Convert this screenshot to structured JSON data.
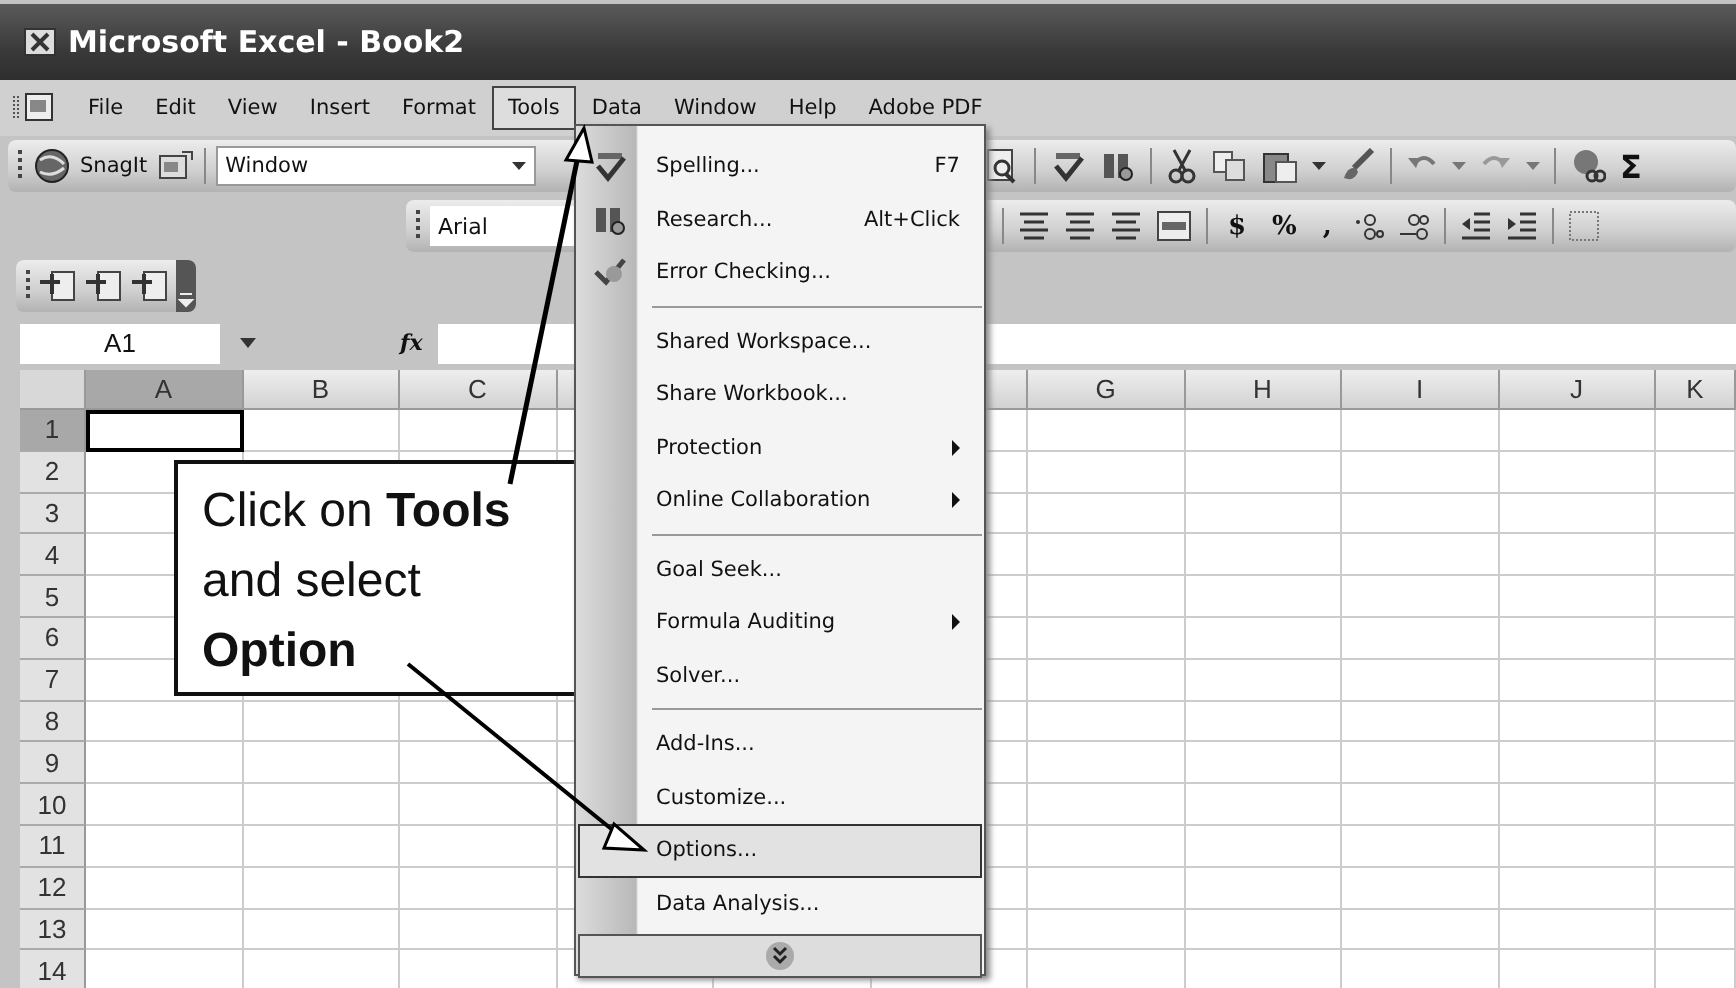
{
  "window": {
    "title": "Microsoft Excel - Book2"
  },
  "menu_bar": [
    {
      "label": "File",
      "selected": false
    },
    {
      "label": "Edit",
      "selected": false
    },
    {
      "label": "View",
      "selected": false
    },
    {
      "label": "Insert",
      "selected": false
    },
    {
      "label": "Format",
      "selected": false
    },
    {
      "label": "Tools",
      "selected": true
    },
    {
      "label": "Data",
      "selected": false
    },
    {
      "label": "Window",
      "selected": false
    },
    {
      "label": "Help",
      "selected": false
    },
    {
      "label": "Adobe PDF",
      "selected": false
    }
  ],
  "standard_toolbar": {
    "app_label": "SnagIt",
    "window_select": "Window",
    "sum": "Σ"
  },
  "formatting_toolbar": {
    "font": "Arial",
    "currency": "$",
    "percent": "%",
    "comma": ","
  },
  "formula_bar": {
    "name_box": "A1",
    "fx": "fx"
  },
  "columns": [
    {
      "label": "A",
      "selected": true
    },
    {
      "label": "B",
      "selected": false
    },
    {
      "label": "C",
      "selected": false
    },
    {
      "label": "G",
      "selected": false
    },
    {
      "label": "H",
      "selected": false
    },
    {
      "label": "I",
      "selected": false
    },
    {
      "label": "J",
      "selected": false
    },
    {
      "label": "K",
      "selected": false
    }
  ],
  "rows": [
    {
      "label": "1",
      "selected": true
    },
    {
      "label": "2",
      "selected": false
    },
    {
      "label": "3",
      "selected": false
    },
    {
      "label": "4",
      "selected": false
    },
    {
      "label": "5",
      "selected": false
    },
    {
      "label": "6",
      "selected": false
    },
    {
      "label": "7",
      "selected": false
    },
    {
      "label": "8",
      "selected": false
    },
    {
      "label": "9",
      "selected": false
    },
    {
      "label": "10",
      "selected": false
    },
    {
      "label": "11",
      "selected": false
    },
    {
      "label": "12",
      "selected": false
    },
    {
      "label": "13",
      "selected": false
    },
    {
      "label": "14",
      "selected": false
    }
  ],
  "tools_menu": [
    {
      "kind": "icon-item",
      "label": "Spelling...",
      "shortcut": "F7",
      "submenu": false,
      "selected": false
    },
    {
      "kind": "icon-item",
      "label": "Research...",
      "shortcut": "Alt+Click",
      "submenu": false,
      "selected": false
    },
    {
      "kind": "icon-item",
      "label": "Error Checking...",
      "submenu": false,
      "selected": false
    },
    {
      "kind": "separator"
    },
    {
      "kind": "item",
      "label": "Shared Workspace...",
      "submenu": false,
      "selected": false
    },
    {
      "kind": "item",
      "label": "Share Workbook...",
      "submenu": false,
      "selected": false
    },
    {
      "kind": "item",
      "label": "Protection",
      "submenu": true,
      "selected": false
    },
    {
      "kind": "item",
      "label": "Online Collaboration",
      "submenu": true,
      "selected": false
    },
    {
      "kind": "separator"
    },
    {
      "kind": "item",
      "label": "Goal Seek...",
      "submenu": false,
      "selected": false
    },
    {
      "kind": "item",
      "label": "Formula Auditing",
      "submenu": true,
      "selected": false
    },
    {
      "kind": "item",
      "label": "Solver...",
      "submenu": false,
      "selected": false
    },
    {
      "kind": "separator"
    },
    {
      "kind": "item",
      "label": "Add-Ins...",
      "submenu": false,
      "selected": false
    },
    {
      "kind": "item",
      "label": "Customize...",
      "submenu": false,
      "selected": false
    },
    {
      "kind": "item",
      "label": "Options...",
      "submenu": false,
      "selected": true
    },
    {
      "kind": "item",
      "label": "Data Analysis...",
      "submenu": false,
      "selected": false
    },
    {
      "kind": "more"
    }
  ],
  "callout": {
    "lines": [
      "Click on **Tools**",
      "and select",
      "**Option**"
    ]
  }
}
